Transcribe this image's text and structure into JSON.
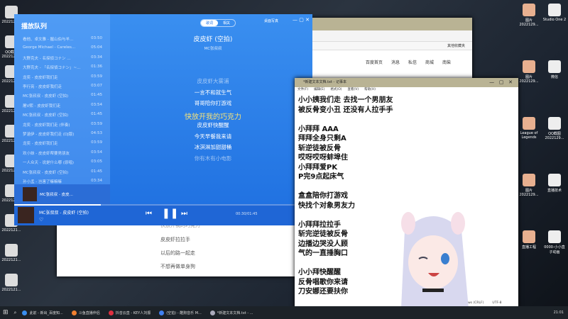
{
  "desktop": {
    "left_icons": [
      "2022121...",
      "QQ截图2022121...",
      "2022121...",
      "2022121...",
      "2022121...",
      "2022121...",
      "2022121...",
      "2022121...",
      "2022121...",
      "2022121..."
    ],
    "right_icons": [
      "图片2022129...",
      "Studio One 2",
      "图片2022129...",
      "微信",
      "League of Legends",
      "QQ截图2022129...",
      "图片2022129...",
      "直播技术",
      "直播工程",
      "0000-小小直子动画"
    ]
  },
  "browser": {
    "bookmark": "其他收藏夹",
    "nav": [
      "百度首页",
      "消息",
      "私信",
      "商城",
      "南柴"
    ],
    "lines": [
      "快放开我的巧克力",
      "皮皮虾拉拉手",
      "以后的路一起走",
      "不想再做单身狗"
    ]
  },
  "player": {
    "queue_title": "播放队列",
    "queue": [
      {
        "t": "看他、卓文雅 - 握山伯与羊...",
        "d": "03:50"
      },
      {
        "t": "George Michael - Careles...",
        "d": "05:04"
      },
      {
        "t": "大野克夫 - 名探偵コナン ...",
        "d": "03:34"
      },
      {
        "t": "大野克夫 - 「名探偵コナン」~...",
        "d": "01:36"
      },
      {
        "t": "龙奕 - 皮皮虾我们走",
        "d": "03:59"
      },
      {
        "t": "李行亮 - 皮皮虾我们走",
        "d": "03:07"
      },
      {
        "t": "MC张叔叔 - 皮皮虾 (空拍)",
        "d": "01:45"
      },
      {
        "t": "屠V熙 - 皮皮虾我们走",
        "d": "03:54"
      },
      {
        "t": "MC张叔叔 - 皮皮虾 (空拍)",
        "d": "01:45"
      },
      {
        "t": "龙奕 - 皮皮虾我们走 (伴奏)",
        "d": "03:59"
      },
      {
        "t": "梦涵伊 - 皮皮虾我们走 (DJ版)",
        "d": "04:53"
      },
      {
        "t": "龙奕 - 皮皮虾我们走",
        "d": "03:59"
      },
      {
        "t": "欢小妹 - 皮皮虾帮要男朋友",
        "d": "03:54"
      },
      {
        "t": "一人众天 - 说是什么哪 (原唱)",
        "d": "03:05"
      },
      {
        "t": "MC张叔叔 - 皮皮虾 (空拍)",
        "d": "01:45"
      },
      {
        "t": "孙小孟 - 岂害了嘛嘛嘛",
        "d": "03:34"
      }
    ],
    "queue_now": "MC张叔叔 - 皮皮...",
    "tabs": [
      "歌词",
      "相关"
    ],
    "desk_lyric": "桌面写真",
    "song": "皮皮虾 (空拍)",
    "artist": "MC张叔叔",
    "lyrics": [
      "皮皮虾大雾浦",
      "一言不和就生气",
      "哥哥陪你打游戏",
      "快放开我的巧克力",
      "皮皮虾快醒醒",
      "今天早餐我来请",
      "冰淇淋加甜甜桶",
      "你有木有小电影"
    ],
    "now_playing": "MC张叔叔 - 皮皮虾 (空拍)",
    "time": "00:30/01:45",
    "progress": 0.29,
    "accent": "#f5e27a"
  },
  "notepad": {
    "title": "*新建文本文档.txt - 记事本",
    "menu": [
      "文件(F)",
      "编辑(E)",
      "格式(O)",
      "查看(V)",
      "帮助(H)"
    ],
    "lines": [
      "小小姨我们走 去找一个男朋友",
      "被反骨变小丑 还没有人拉手手",
      "",
      "小拜拜 AAA",
      "拜拜全身只剩A",
      "斩逆徒被反骨",
      "哎呀哎呀蚌埠住",
      "小拜拜爱PK",
      "P完9点起床气",
      "",
      "盒盒陪你打游戏",
      "快找个对象男友力",
      "",
      "小拜拜拉拉手",
      "斩完逆徒被反骨",
      "边播边哭没人顾",
      "气的一直捶胸口",
      "",
      "小小拜快醒醒",
      "反骨唱歌你来请",
      "刀安娜还要扶你"
    ],
    "status": [
      "Windows (CRLF)",
      "UTF-8"
    ]
  },
  "taskbar": {
    "items": [
      "此前 - 新出_百度知...",
      "斗鱼直播伴侣",
      "抖音云直 - KEY人刘振",
      "(空拍) - 酷狗音乐 M...",
      "*新建文本文档.txt - ..."
    ],
    "clock": "21:01"
  }
}
